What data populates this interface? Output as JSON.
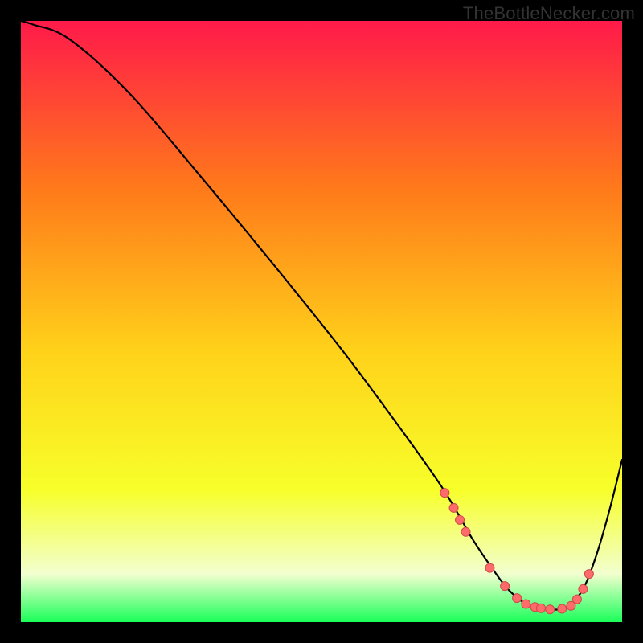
{
  "watermark": "TheBottleNecker.com",
  "colors": {
    "background": "#000000",
    "gradient_top": "#ff1a4a",
    "gradient_upper_mid": "#ff7a1a",
    "gradient_mid": "#ffd21a",
    "gradient_lower_mid": "#f7ff2a",
    "gradient_pale": "#f2ffcf",
    "gradient_green": "#1aff59",
    "curve": "#000000",
    "marker_fill": "#ff6a6a",
    "marker_stroke": "#cc4a4a"
  },
  "chart_data": {
    "type": "line",
    "title": "",
    "xlabel": "",
    "ylabel": "",
    "xlim": [
      0,
      100
    ],
    "ylim": [
      0,
      100
    ],
    "curve": {
      "x": [
        0,
        2,
        8,
        18,
        30,
        42,
        54,
        64,
        70,
        73,
        75,
        78,
        81,
        84,
        86,
        88,
        90,
        92,
        94,
        96,
        98,
        100
      ],
      "y": [
        100,
        99.4,
        97,
        88,
        74,
        59.5,
        44.5,
        31,
        22.5,
        17.5,
        14,
        9.5,
        5.5,
        3,
        2.3,
        2.1,
        2.2,
        3.4,
        6.5,
        12,
        19,
        27
      ]
    },
    "markers": {
      "x": [
        70.5,
        72,
        73,
        74,
        78,
        80.5,
        82.5,
        84,
        85.5,
        86.5,
        88,
        90,
        91.5,
        92.5,
        93.5,
        94.5
      ],
      "y": [
        21.5,
        19,
        17,
        15,
        9.0,
        6.0,
        4.0,
        3.0,
        2.5,
        2.3,
        2.1,
        2.2,
        2.7,
        3.8,
        5.5,
        8.0
      ]
    }
  }
}
